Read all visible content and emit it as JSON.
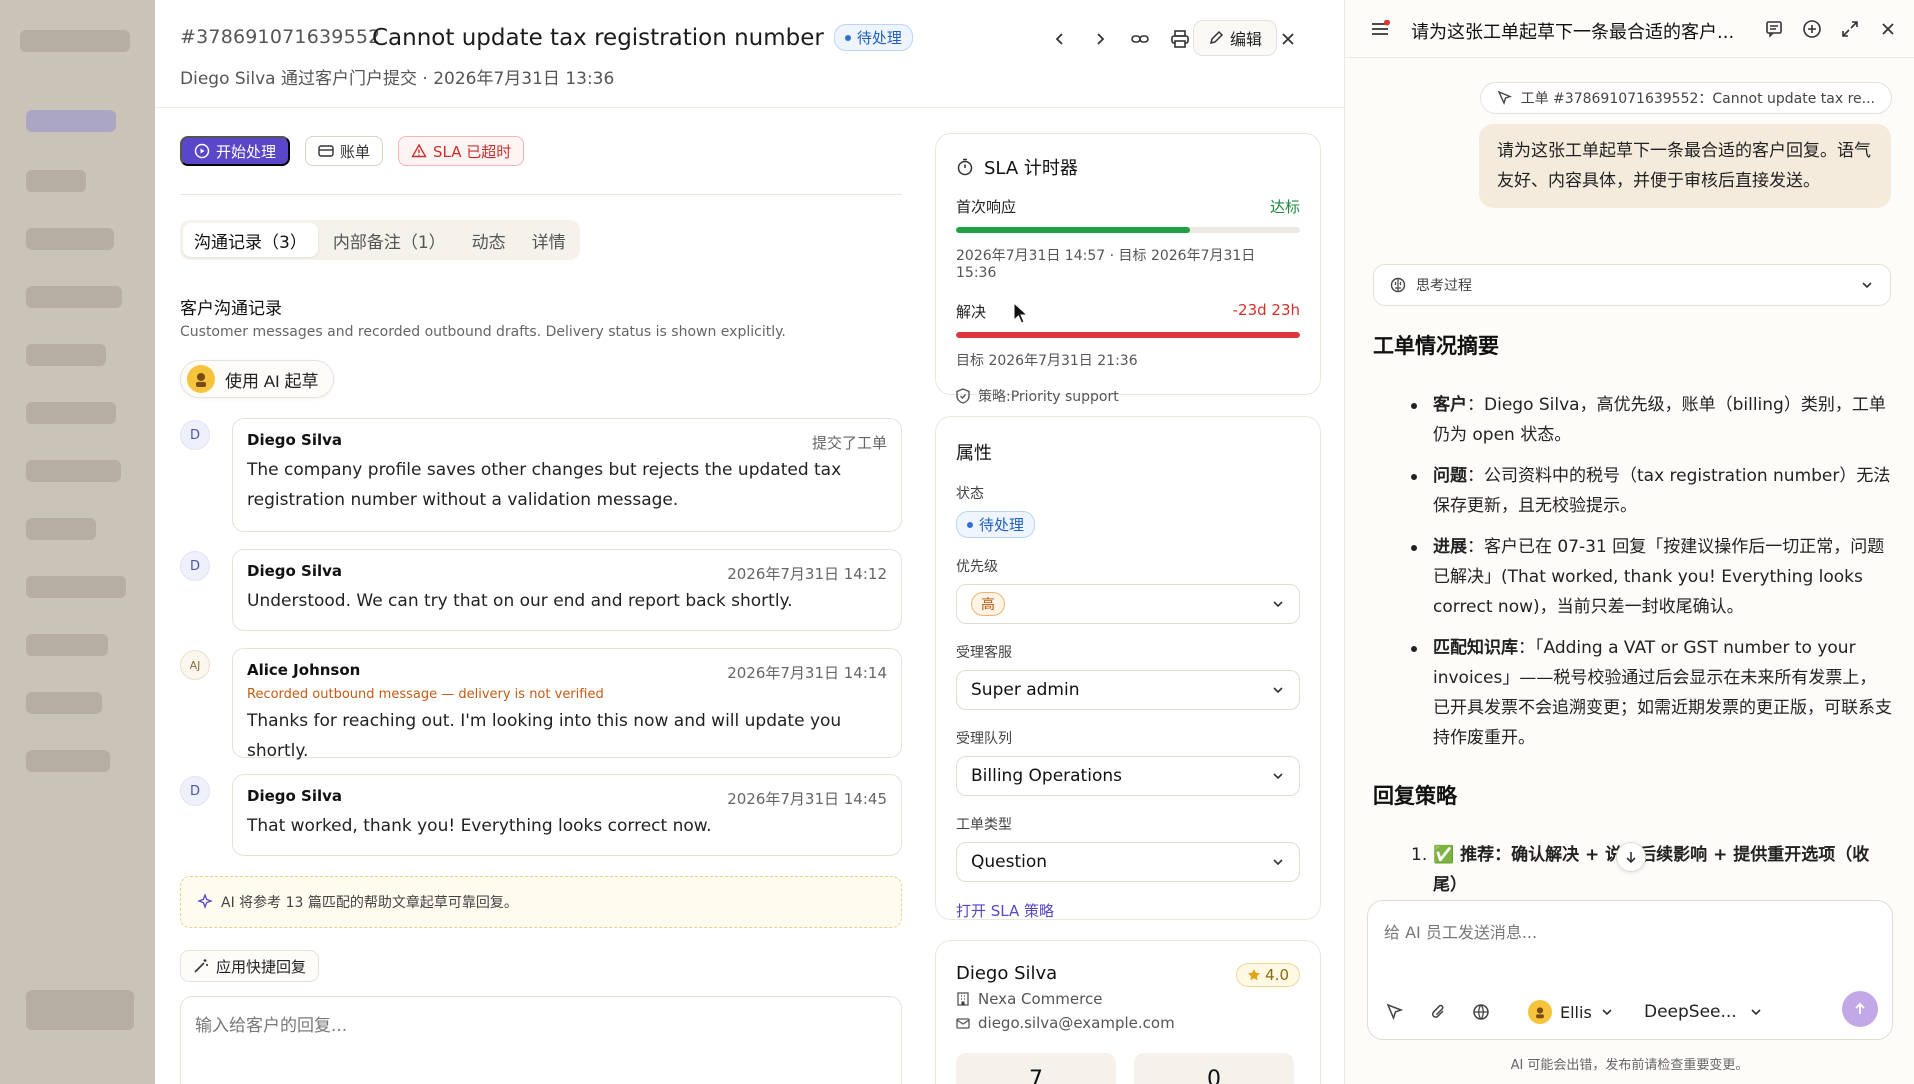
{
  "ticket": {
    "id": "#378691071639552",
    "title": "Cannot update tax registration number",
    "status": "待处理",
    "subtitle": "Diego Silva 通过客户门户提交 · 2026年7月31日 13:36",
    "edit_label": "编辑",
    "actions": {
      "start": "开始处理",
      "billing": "账单",
      "sla": "SLA 已超时"
    },
    "tabs": [
      "沟通记录（3）",
      "内部备注（1）",
      "动态",
      "详情"
    ],
    "section_title": "客户沟通记录",
    "section_desc": "Customer messages and recorded outbound drafts. Delivery status is shown explicitly.",
    "ai_draft_label": "使用 AI 起草",
    "messages": [
      {
        "avatar": "D",
        "name": "Diego Silva",
        "time": "提交了工单",
        "note": "",
        "text": "The company profile saves other changes but rejects the updated tax registration number without a validation message."
      },
      {
        "avatar": "D",
        "name": "Diego Silva",
        "time": "2026年7月31日 14:12",
        "note": "",
        "text": "Understood. We can try that on our end and report back shortly."
      },
      {
        "avatar": "AJ",
        "name": "Alice Johnson",
        "time": "2026年7月31日 14:14",
        "note": "Recorded outbound message — delivery is not verified",
        "text": "Thanks for reaching out. I'm looking into this now and will update you shortly."
      },
      {
        "avatar": "D",
        "name": "Diego Silva",
        "time": "2026年7月31日 14:45",
        "note": "",
        "text": "That worked, thank you! Everything looks correct now."
      }
    ],
    "ai_hint": "AI 将参考 13 篇匹配的帮助文章起草可靠回复。",
    "quick_reply": "应用快捷回复",
    "reply_placeholder": "输入给客户的回复..."
  },
  "sla": {
    "title": "SLA 计时器",
    "first_response": {
      "label": "首次响应",
      "status": "达标",
      "progress": 0.68,
      "meta": "2026年7月31日 14:57 · 目标 2026年7月31日 15:36"
    },
    "resolution": {
      "label": "解决",
      "status": "-23d 23h",
      "progress": 1.0,
      "meta": "目标 2026年7月31日 21:36"
    },
    "policy": "策略:Priority support"
  },
  "attributes": {
    "title": "属性",
    "status_label": "状态",
    "status_value": "待处理",
    "priority_label": "优先级",
    "priority_value": "高",
    "assignee_label": "受理客服",
    "assignee_value": "Super admin",
    "queue_label": "受理队列",
    "queue_value": "Billing Operations",
    "type_label": "工单类型",
    "type_value": "Question",
    "sla_link": "打开 SLA 策略"
  },
  "customer": {
    "name": "Diego Silva",
    "rating": "4.0",
    "company": "Nexa Commerce",
    "email": "diego.silva@example.com",
    "stat1": "7",
    "stat2": "0"
  },
  "chat": {
    "title": "请为这张工单起草下一条最合适的客户...",
    "context_chip": "工单 #378691071639552：Cannot update tax re...",
    "user_message": "请为这张工单起草下一条最合适的客户回复。语气友好、内容具体，并便于审核后直接发送。",
    "thinking_label": "思考过程",
    "summary_heading": "工单情况摘要",
    "bullets": [
      {
        "key": "客户",
        "text": "：Diego Silva，高优先级，账单（billing）类别，工单仍为 open 状态。"
      },
      {
        "key": "问题",
        "text": "：公司资料中的税号（tax registration number）无法保存更新，且无校验提示。"
      },
      {
        "key": "进展",
        "text": "：客户已在 07-31 回复「按建议操作后一切正常，问题已解决」(That worked, thank you! Everything looks correct now)，当前只差一封收尾确认。"
      },
      {
        "key": "匹配知识库",
        "text": "：「Adding a VAT or GST number to your invoices」——税号校验通过后会显示在未来所有发票上，已开具发票不会追溯变更；如需近期发票的更正版，可联系支持作废重开。"
      }
    ],
    "strategy_heading": "回复策略",
    "strategy_item_num": "1.",
    "strategy_item": "✅ 推荐：确认解决 + 说明后续影响 + 提供重开选项（收尾）",
    "composer_placeholder": "给 AI 员工发送消息...",
    "agent": "Ellis",
    "model": "DeepSee...",
    "disclaimer": "AI 可能会出错，发布前请检查重要变更。"
  }
}
